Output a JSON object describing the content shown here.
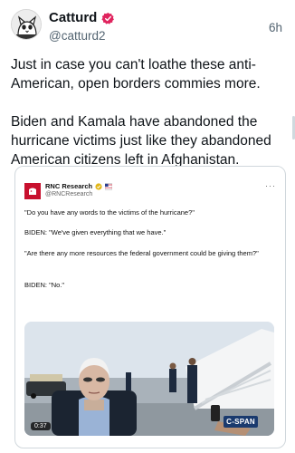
{
  "author": {
    "name": "Catturd",
    "handle": "@catturd2",
    "timestamp": "6h"
  },
  "tweet": {
    "paragraphs": [
      "Just in case you can't loathe these anti-American, open borders commies more.",
      "Biden and Kamala have abandoned the hurricane victims just like they abandoned American citizens left in Afghanistan."
    ]
  },
  "quoted_post": {
    "name": "RNC Research",
    "handle": "@RNCResearch",
    "lines": [
      "\"Do you have any words to the victims of the hurricane?\"",
      "BIDEN: \"We've given everything that we have.\"",
      "\"Are there any more resources the federal government could be giving them?\"",
      "BIDEN: \"No.\""
    ],
    "video": {
      "duration": "0:37",
      "network_bug": "C-SPAN"
    }
  },
  "colors": {
    "text": "#0f1419",
    "secondary": "#536471",
    "verified": "#e0245e",
    "rnc_red": "#c8102e"
  }
}
